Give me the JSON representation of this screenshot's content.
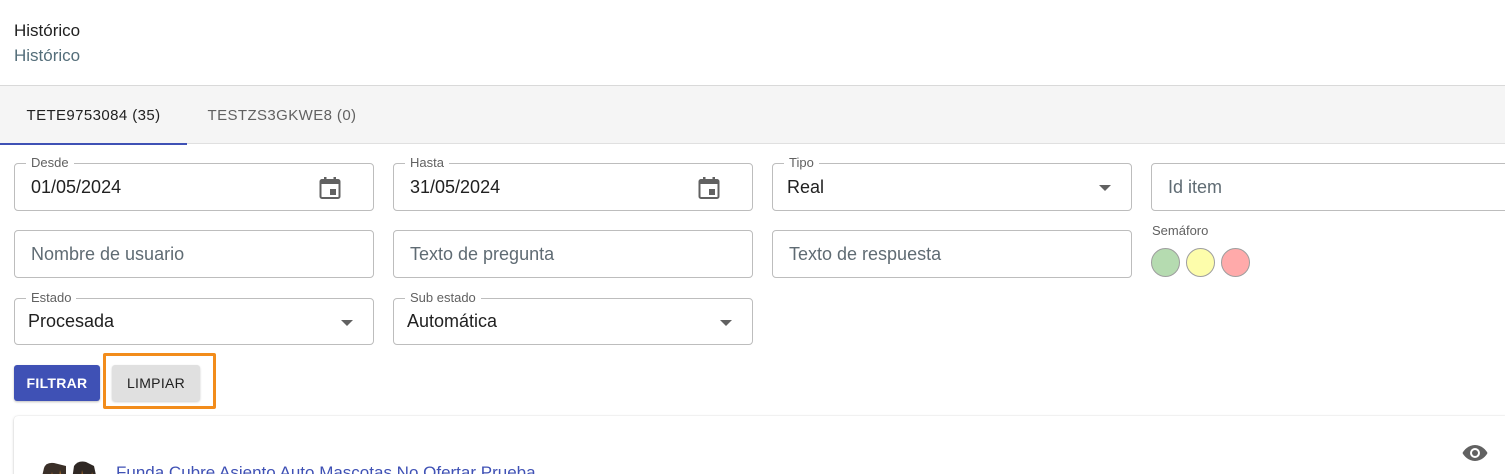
{
  "header": {
    "title": "Histórico",
    "subtitle": "Histórico"
  },
  "tabs": [
    {
      "label": "TETE9753084 (35)",
      "active": true
    },
    {
      "label": "TESTZS3GKWE8 (0)",
      "active": false
    }
  ],
  "filters": {
    "desde": {
      "label": "Desde",
      "value": "01/05/2024",
      "icon": "calendar-icon"
    },
    "hasta": {
      "label": "Hasta",
      "value": "31/05/2024",
      "icon": "calendar-icon"
    },
    "tipo": {
      "label": "Tipo",
      "value": "Real"
    },
    "id_item": {
      "placeholder": "Id item"
    },
    "nombre_usuario": {
      "placeholder": "Nombre de usuario"
    },
    "texto_pregunta": {
      "placeholder": "Texto de pregunta"
    },
    "texto_respuesta": {
      "placeholder": "Texto de respuesta"
    },
    "semaforo": {
      "label": "Semáforo",
      "colors": [
        "#b5dbb0",
        "#fdfdab",
        "#ffaaaa"
      ]
    },
    "estado": {
      "label": "Estado",
      "value": "Procesada"
    },
    "sub_estado": {
      "label": "Sub estado",
      "value": "Automática"
    }
  },
  "actions": {
    "filter_label": "FILTRAR",
    "clear_label": "LIMPIAR"
  },
  "results": [
    {
      "title": "Funda Cubre Asiento Auto Mascotas No Ofertar Prueba",
      "action_icon": "eye-icon"
    }
  ],
  "colors": {
    "primary": "#3f51b5",
    "highlight": "#f28c1b"
  }
}
